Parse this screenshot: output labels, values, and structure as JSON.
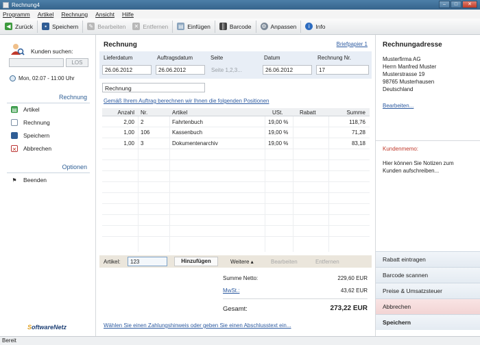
{
  "window": {
    "title": "Rechnung4",
    "controls": [
      "–",
      "□",
      "✕"
    ]
  },
  "menu": [
    "Programm",
    "Artikel",
    "Rechnung",
    "Ansicht",
    "Hilfe"
  ],
  "toolbar": {
    "back": "Zurück",
    "save": "Speichern",
    "edit": "Bearbeiten",
    "remove": "Entfernen",
    "paste": "Einfügen",
    "barcode": "Barcode",
    "customize": "Anpassen",
    "info": "Info"
  },
  "sidebar": {
    "search_label": "Kunden suchen:",
    "search_value": "",
    "search_button": "LOS",
    "date": "Mon, 02.07 - 11:00 Uhr",
    "section_invoice": "Rechnung",
    "invoice_items": [
      "Artikel",
      "Rechnung",
      "Speichern",
      "Abbrechen"
    ],
    "section_options": "Optionen",
    "option_items": [
      "Beenden"
    ],
    "logo_prefix": "S",
    "logo_rest": "oftwareNetz"
  },
  "invoice": {
    "title": "Rechnung",
    "letterhead_link": "Briefpapier 1",
    "fields": {
      "delivery_label": "Lieferdatum",
      "delivery_value": "26.06.2012",
      "order_label": "Auftragsdatum",
      "order_value": "26.06.2012",
      "page_label": "Seite",
      "page_placeholder": "Seite 1,2,3...",
      "date_label": "Datum",
      "date_value": "26.06.2012",
      "number_label": "Rechnung Nr.",
      "number_value": "17"
    },
    "name_value": "Rechnung",
    "calc_link": "Gemäß Ihrem Auftrag berechnen wir Ihnen die folgenden Positionen",
    "columns": [
      "Anzahl",
      "Nr.",
      "Artikel",
      "USt.",
      "Rabatt",
      "Summe"
    ],
    "rows": [
      {
        "qty": "2,00",
        "nr": "2",
        "article": "Fahrtenbuch",
        "vat": "19,00 %",
        "discount": "",
        "sum": "118,76"
      },
      {
        "qty": "1,00",
        "nr": "106",
        "article": "Kassenbuch",
        "vat": "19,00 %",
        "discount": "",
        "sum": "71,28"
      },
      {
        "qty": "1,00",
        "nr": "3",
        "article": "Dokumentenarchiv",
        "vat": "19,00 %",
        "discount": "",
        "sum": "83,18"
      }
    ],
    "article_bar": {
      "label": "Artikel:",
      "input_value": "123",
      "add_button": "Hinzufügen",
      "more_button": "Weitere ▴",
      "edit_button": "Bearbeiten",
      "remove_button": "Entfernen"
    },
    "totals": {
      "net_label": "Summe Netto:",
      "net_value": "229,60 EUR",
      "vat_label": "MwSt.:",
      "vat_value": "43,62 EUR",
      "gross_label": "Gesamt:",
      "gross_value": "273,22 EUR"
    },
    "payment_link": "Wählen Sie einen Zahlungshinweis oder geben Sie einen Abschlusstext ein..."
  },
  "address": {
    "title": "Rechnungadresse",
    "lines": [
      "Musterfirma AG",
      "Herrn Manfred Muster",
      "Musterstrasse 19",
      "98765 Musterhausen",
      "Deutschland"
    ],
    "edit_link": "Bearbeiten..."
  },
  "memo": {
    "title": "Kundenmemo:",
    "text": "Hier können Sie Notizen zum Kunden aufschreiben..."
  },
  "actions": [
    "Rabatt eintragen",
    "Barcode scannen",
    "Preise & Umsatzsteuer",
    "Abbrechen",
    "Speichern"
  ],
  "status": "Bereit",
  "colors": {
    "accent": "#2c5aa0",
    "memo": "#c0392b",
    "logo": "#1d3f74"
  }
}
